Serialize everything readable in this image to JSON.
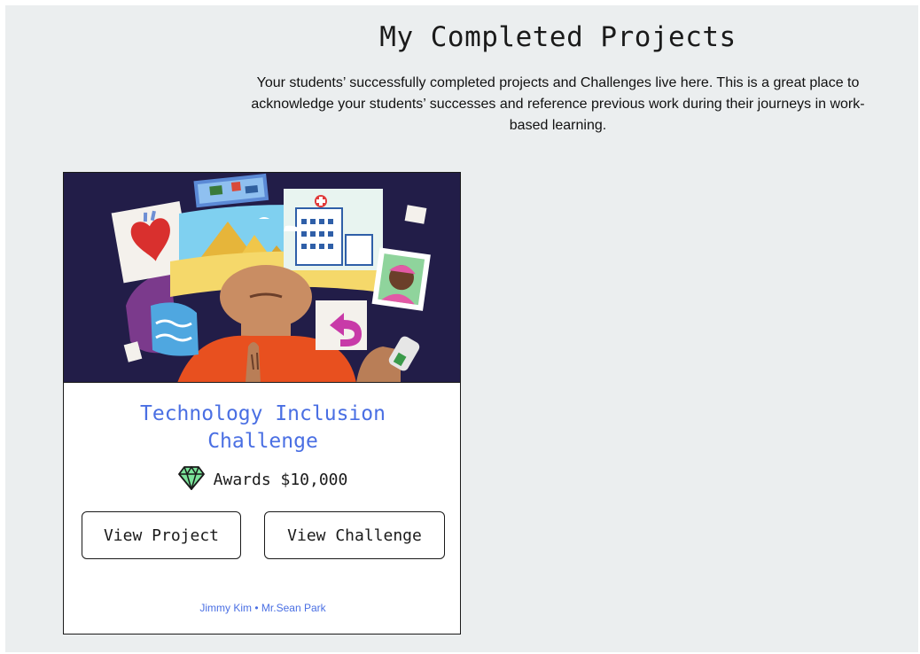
{
  "page": {
    "title": "My Completed Projects",
    "description": "Your students’ successfully completed projects and Challenges live here. This is a great place to acknowledge your students’ successes and reference previous work during their journeys in work-based learning."
  },
  "project_card": {
    "image_icon": "project-illustration",
    "title": "Technology Inclusion Challenge",
    "award_icon": "diamond-icon",
    "award_text": "Awards $10,000",
    "view_project_label": "View Project",
    "view_challenge_label": "View Challenge",
    "student": "Jimmy Kim",
    "separator": " • ",
    "teacher": "Mr.Sean Park"
  },
  "colors": {
    "background": "#ebeeef",
    "accent": "#4a6fe3",
    "image_background": "#221d48"
  }
}
